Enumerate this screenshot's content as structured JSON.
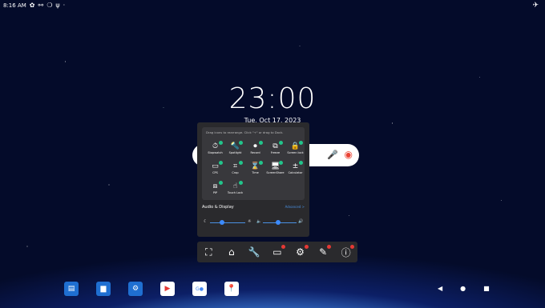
{
  "status_bar": {
    "time": "8:16 AM",
    "icons": [
      "settings-icon",
      "usb-icon",
      "circle-icon",
      "usb-icon"
    ],
    "right_icon": "airplane-icon"
  },
  "clock": {
    "time": "23:00",
    "date": "Tue, Oct 17, 2023"
  },
  "quick_panel": {
    "hint": "Drag icons to rearrange. Click \"+\" or drag to Dock.",
    "tools": [
      {
        "name": "stopwatch",
        "label": "Stopwatch",
        "glyph": "⏱"
      },
      {
        "name": "spotlight",
        "label": "Spotlight",
        "glyph": "🔦"
      },
      {
        "name": "record",
        "label": "Record",
        "glyph": "⏺"
      },
      {
        "name": "freeze",
        "label": "Freeze",
        "glyph": "⧉"
      },
      {
        "name": "screen-lock",
        "label": "Screen lock",
        "glyph": "🔒"
      },
      {
        "name": "cast",
        "label": "CPS",
        "glyph": "▭"
      },
      {
        "name": "crop",
        "label": "Crop",
        "glyph": "⌗"
      },
      {
        "name": "timer",
        "label": "Time",
        "glyph": "⌛"
      },
      {
        "name": "screenshare",
        "label": "ScreenShare",
        "glyph": "🖥"
      },
      {
        "name": "calculator",
        "label": "Calculator",
        "glyph": "±"
      },
      {
        "name": "pip",
        "label": "PIP",
        "glyph": "⧈"
      },
      {
        "name": "touch-lock",
        "label": "Touch Lock",
        "glyph": "☝"
      }
    ],
    "audio_title": "Audio & Display",
    "audio_link": "Advanced >",
    "brightness": 0.35,
    "volume": 0.45
  },
  "toolbar": [
    "expand-icon",
    "home-icon",
    "tools-icon",
    "screen-icon",
    "settings-icon",
    "pen-icon",
    "info-icon"
  ],
  "dock_apps": [
    "whiteboard",
    "files",
    "settings",
    "play-store",
    "google-apps",
    "maps"
  ],
  "nav": [
    "◀",
    "●",
    "■"
  ]
}
